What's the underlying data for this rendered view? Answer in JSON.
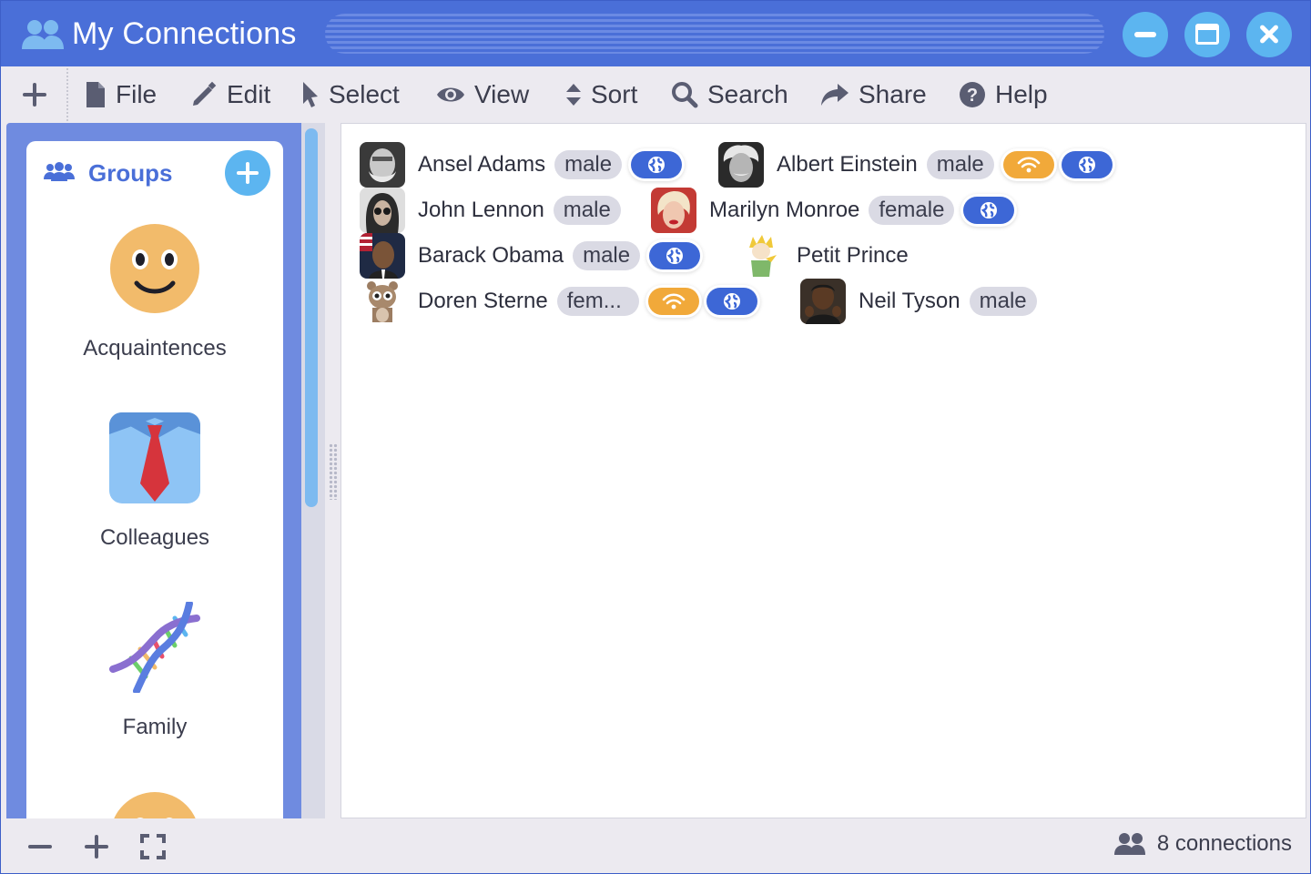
{
  "window": {
    "title": "My Connections"
  },
  "menu": {
    "items": [
      {
        "label": "File",
        "icon": "file-icon"
      },
      {
        "label": "Edit",
        "icon": "pencil-icon"
      },
      {
        "label": "Select",
        "icon": "pointer-icon"
      },
      {
        "label": "View",
        "icon": "eye-icon"
      },
      {
        "label": "Sort",
        "icon": "sort-icon"
      },
      {
        "label": "Search",
        "icon": "search-icon"
      },
      {
        "label": "Share",
        "icon": "share-icon"
      },
      {
        "label": "Help",
        "icon": "help-icon"
      }
    ]
  },
  "sidebar": {
    "title": "Groups",
    "groups": [
      {
        "label": "Acquaintences",
        "icon": "smiley-icon"
      },
      {
        "label": "Colleagues",
        "icon": "shirt-tie-icon"
      },
      {
        "label": "Family",
        "icon": "dna-icon"
      }
    ]
  },
  "connections": [
    {
      "name": "Ansel Adams",
      "tag": "male",
      "wifi": false,
      "globe": true
    },
    {
      "name": "Albert Einstein",
      "tag": "male",
      "wifi": true,
      "globe": true
    },
    {
      "name": "John Lennon",
      "tag": "male",
      "wifi": false,
      "globe": false
    },
    {
      "name": "Marilyn Monroe",
      "tag": "female",
      "wifi": false,
      "globe": true
    },
    {
      "name": "Barack Obama",
      "tag": "male",
      "wifi": false,
      "globe": true
    },
    {
      "name": "Petit Prince",
      "tag": "",
      "wifi": false,
      "globe": false
    },
    {
      "name": "Doren Sterne",
      "tag": "fem...",
      "wifi": true,
      "globe": true
    },
    {
      "name": "Neil Tyson",
      "tag": "male",
      "wifi": false,
      "globe": false
    }
  ],
  "status": {
    "count_text": "8 connections"
  },
  "colors": {
    "accent": "#4a6fd8",
    "light_blue": "#5cb5f0",
    "wifi": "#f1a93a",
    "globe": "#3d67d6"
  }
}
